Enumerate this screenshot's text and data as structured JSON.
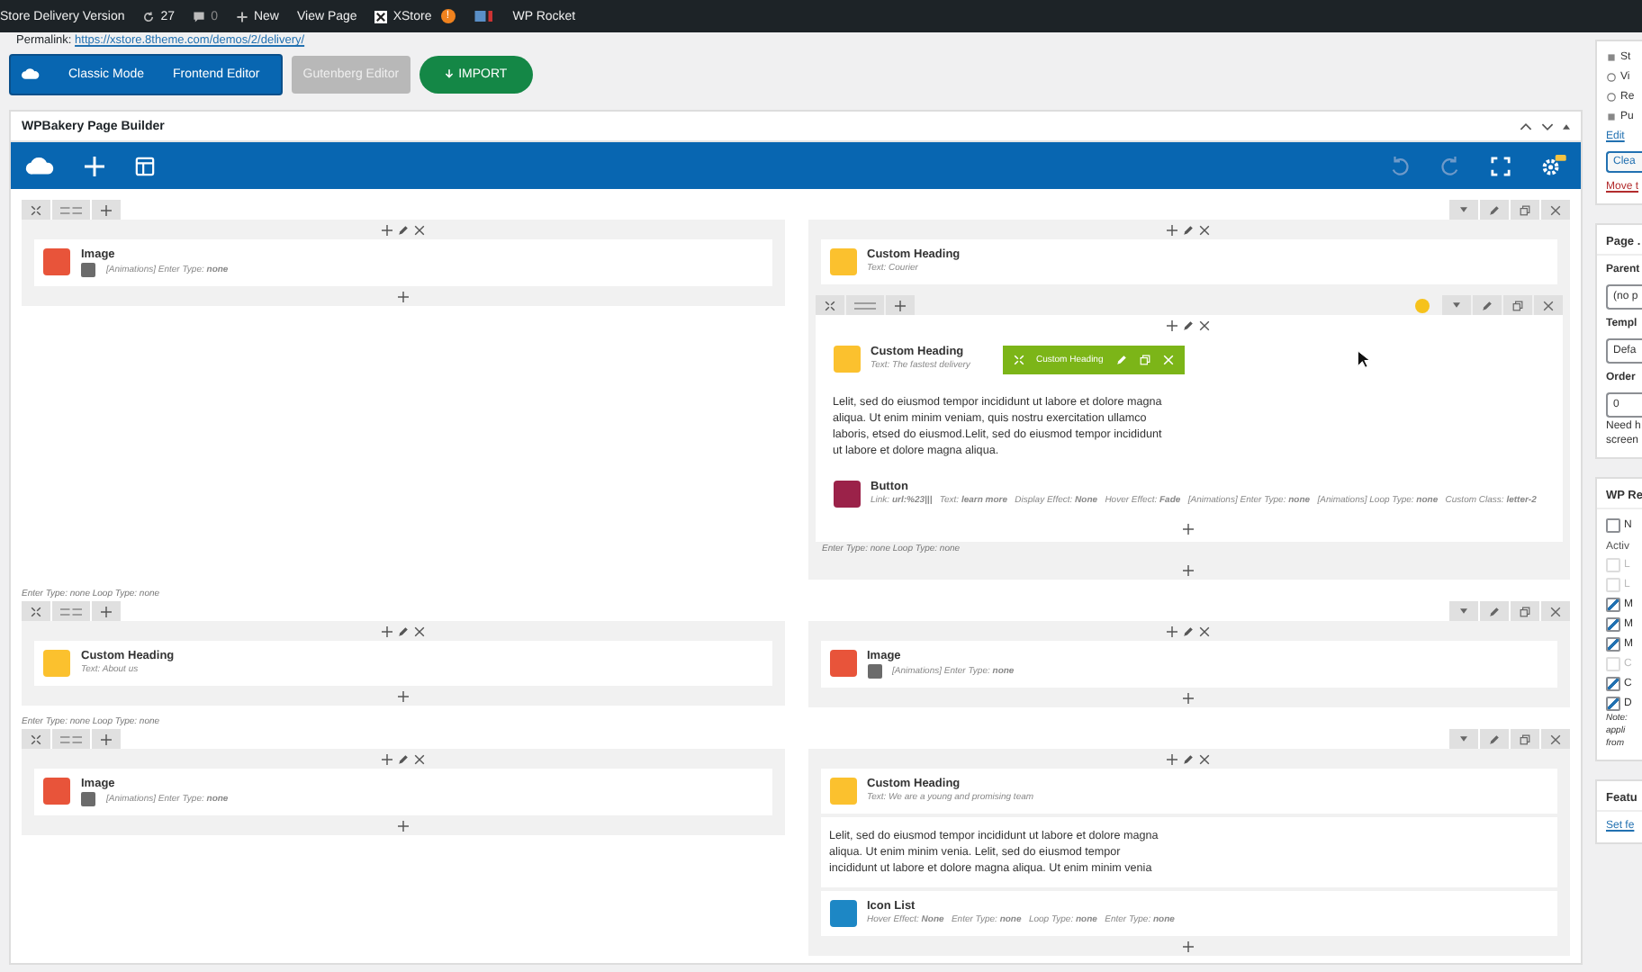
{
  "admin_bar": [
    {
      "kind": "text",
      "label": "Store Delivery Version"
    },
    {
      "kind": "updates",
      "label": "27"
    },
    {
      "kind": "comments",
      "label": "0"
    },
    {
      "kind": "new",
      "label": "New"
    },
    {
      "kind": "text",
      "label": "View Page"
    },
    {
      "kind": "xstore",
      "label": "XStore",
      "badge": "!"
    },
    {
      "kind": "plugin"
    },
    {
      "kind": "text",
      "label": "WP Rocket"
    }
  ],
  "permalink": {
    "label": "Permalink:",
    "url": "https://xstore.8theme.com/demos/2/delivery/"
  },
  "mode_buttons": [
    "Classic Mode",
    "Frontend Editor"
  ],
  "gutenberg_button": "Gutenberg Editor",
  "import_button": "IMPORT",
  "builder": {
    "title": "WPBakery Page Builder",
    "rows": [
      {
        "columns": [
          {
            "elements": [
              {
                "kind": "image",
                "title": "Image",
                "params": "[Animations] Enter Type: **none**"
              }
            ]
          },
          {
            "elements": [
              {
                "kind": "heading",
                "title": "Custom Heading",
                "params": "Text: Courier"
              },
              {
                "kind": "inner_row",
                "note": "Enter Type: none Loop Type: none",
                "elements": [
                  {
                    "kind": "heading",
                    "title": "Custom Heading",
                    "params": "Text: The fastest delivery",
                    "hover_toolbar": "Custom Heading"
                  },
                  {
                    "kind": "text",
                    "text": "Lelit, sed do eiusmod tempor incididunt ut labore et dolore magna aliqua. Ut enim minim veniam, quis nostru exercitation ullamco laboris, etsed do eiusmod.Lelit, sed do eiusmod tempor incididunt ut labore et dolore magna aliqua."
                  },
                  {
                    "kind": "button",
                    "title": "Button",
                    "params": "Link: **url:%23|||**   Text: **learn more**   Display Effect: **None**   Hover Effect: **Fade**   [Animations] Enter Type: **none**   [Animations] Loop Type: **none**   Custom Class: **letter-2**"
                  }
                ]
              }
            ]
          }
        ]
      },
      {
        "note": "Enter Type: none Loop Type: none",
        "columns": [
          {
            "elements": [
              {
                "kind": "heading",
                "title": "Custom Heading",
                "params": "Text: About us"
              }
            ]
          },
          {
            "elements": [
              {
                "kind": "image",
                "title": "Image",
                "params": "[Animations] Enter Type: **none**"
              }
            ]
          }
        ]
      },
      {
        "note": "Enter Type: none Loop Type: none",
        "columns": [
          {
            "elements": [
              {
                "kind": "image",
                "title": "Image",
                "params": "[Animations] Enter Type: **none**"
              }
            ]
          },
          {
            "elements": [
              {
                "kind": "heading",
                "title": "Custom Heading",
                "params": "Text: We are a young and promising team"
              },
              {
                "kind": "text",
                "text": "Lelit, sed do eiusmod tempor incididunt ut labore et dolore magna aliqua. Ut enim minim venia. Lelit, sed do eiusmod tempor incididunt ut labore et dolore magna aliqua. Ut enim minim venia"
              },
              {
                "kind": "icon_list",
                "title": "Icon List",
                "params": "Hover Effect: **None**   Enter Type: **none**   Loop Type: **none**   Enter Type: **none**"
              }
            ]
          }
        ]
      }
    ]
  },
  "sidebar": {
    "publish": {
      "items": [
        {
          "kind": "status",
          "label": "St"
        },
        {
          "kind": "visibility",
          "label": "Vi"
        },
        {
          "kind": "revisions",
          "label": "Re"
        },
        {
          "kind": "schedule",
          "label": "Pu"
        }
      ],
      "edit_link": "Edit",
      "clear_button": "Clea",
      "trash_link": "Move t"
    },
    "page_attributes": {
      "title": "Page .",
      "parent_label": "Parent",
      "parent_value": "(no p",
      "template_label": "Templ",
      "template_value": "Defa",
      "order_label": "Order",
      "order_value": "0",
      "help": [
        "Need h",
        "screen"
      ]
    },
    "wp_rocket": {
      "title": "WP Re",
      "never_cache": {
        "label": "N",
        "checked": false
      },
      "subtitle": "Activ",
      "options": [
        {
          "label": "L",
          "checked": false,
          "disabled": true
        },
        {
          "label": "L",
          "checked": false,
          "disabled": true
        },
        {
          "label": "M",
          "checked": true,
          "disabled": false
        },
        {
          "label": "M",
          "checked": true,
          "disabled": false
        },
        {
          "label": "M",
          "checked": true,
          "disabled": false
        },
        {
          "label": "C",
          "checked": false,
          "disabled": true
        },
        {
          "label": "C",
          "checked": true,
          "disabled": false
        },
        {
          "label": "D",
          "checked": true,
          "disabled": false
        }
      ],
      "note": [
        "Note:",
        "appli",
        "from"
      ]
    },
    "featured": {
      "title": "Featu",
      "link": "Set fe"
    }
  }
}
